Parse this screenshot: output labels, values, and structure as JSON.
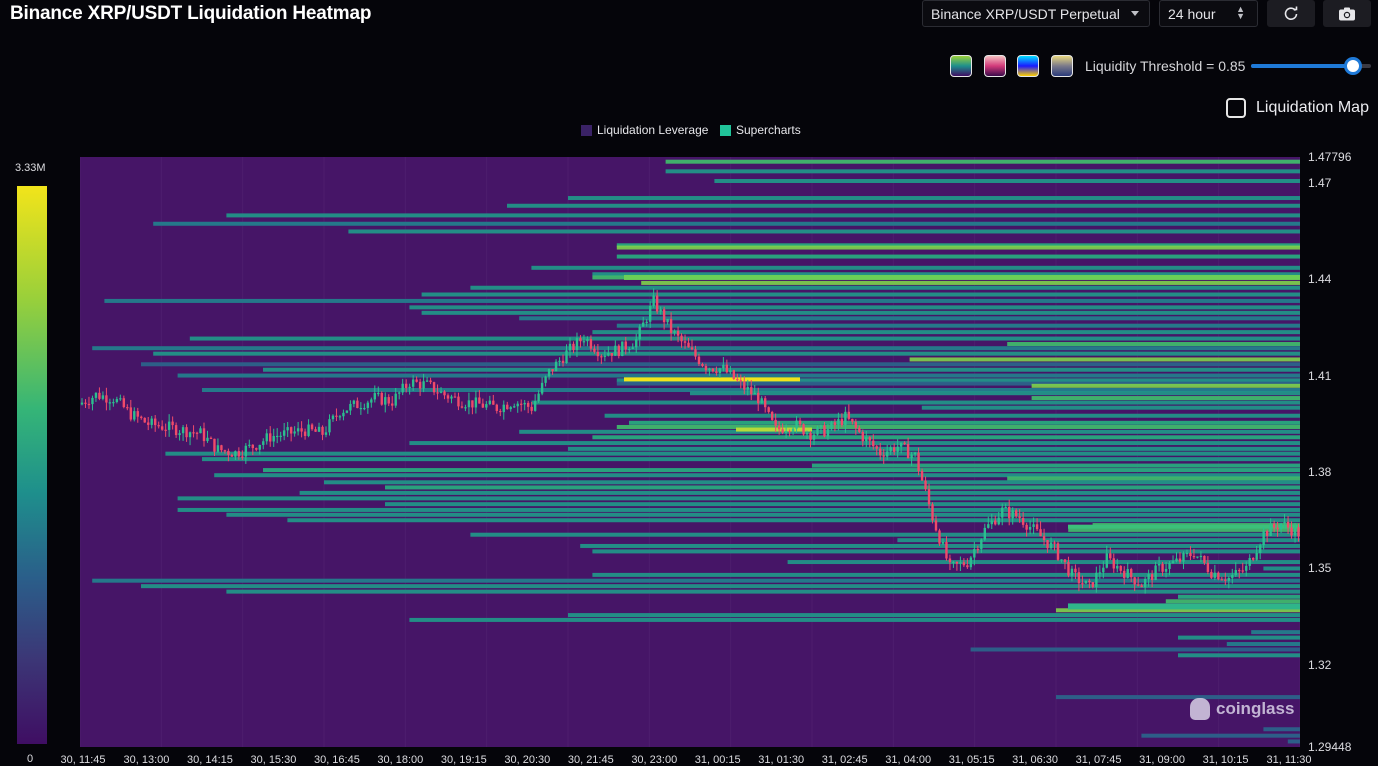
{
  "header": {
    "title": "Binance XRP/USDT Liquidation Heatmap",
    "symbol_select": "Binance XRP/USDT Perpetual",
    "period_select": "24 hour",
    "refresh_icon": "refresh-icon",
    "camera_icon": "camera-icon"
  },
  "controls": {
    "threshold_label": "Liquidity Threshold = 0.85",
    "threshold_value": 0.85,
    "liquidation_map_label": "Liquidation Map",
    "liquidation_map_checked": false,
    "palettes": [
      {
        "name": "palette-viridis",
        "from": "#35b577",
        "to": "#3f0e63"
      },
      {
        "name": "palette-magma",
        "from": "#f07ba0",
        "to": "#3a0a4a"
      },
      {
        "name": "palette-jet",
        "from": "#00e0ff",
        "to": "#1a1aff"
      },
      {
        "name": "palette-cividis",
        "from": "#e8d880",
        "to": "#2a3a7a"
      }
    ]
  },
  "colors": {
    "background": "#461567",
    "up": "#2bbf8f",
    "down": "#f04a6a",
    "highlight": "#f2e41a"
  },
  "watermark": "coinglass",
  "chart_data": {
    "type": "heatmap",
    "title": "Binance XRP/USDT Liquidation Heatmap",
    "legend": [
      "Liquidation Leverage",
      "Supercharts"
    ],
    "legend_colors": [
      "#3a2266",
      "#21c49a"
    ],
    "colorbar": {
      "max_label": "3.33M",
      "min_label": "0"
    },
    "y_axis": {
      "ticks": [
        "1.47796",
        "1.47",
        "1.44",
        "1.41",
        "1.38",
        "1.35",
        "1.32",
        "1.29448"
      ],
      "min": 1.29448,
      "max": 1.47796
    },
    "x_axis": {
      "ticks": [
        "30, 11:45",
        "30, 13:00",
        "30, 14:15",
        "30, 15:30",
        "30, 16:45",
        "30, 18:00",
        "30, 19:15",
        "30, 20:30",
        "30, 21:45",
        "30, 23:00",
        "31, 00:15",
        "31, 01:30",
        "31, 02:45",
        "31, 04:00",
        "31, 05:15",
        "31, 06:30",
        "31, 07:45",
        "31, 09:00",
        "31, 10:15",
        "31, 11:30"
      ]
    },
    "price_path": [
      1.401,
      1.404,
      1.403,
      1.398,
      1.395,
      1.394,
      1.393,
      1.392,
      1.387,
      1.386,
      1.388,
      1.391,
      1.392,
      1.393,
      1.392,
      1.399,
      1.401,
      1.403,
      1.402,
      1.408,
      1.407,
      1.404,
      1.402,
      1.401,
      1.4,
      1.402,
      1.4,
      1.411,
      1.417,
      1.422,
      1.417,
      1.418,
      1.421,
      1.433,
      1.424,
      1.418,
      1.413,
      1.412,
      1.407,
      1.403,
      1.393,
      1.395,
      1.392,
      1.393,
      1.397,
      1.391,
      1.386,
      1.388,
      1.385,
      1.366,
      1.35,
      1.352,
      1.362,
      1.368,
      1.366,
      1.361,
      1.356,
      1.348,
      1.344,
      1.353,
      1.349,
      1.345,
      1.35,
      1.352,
      1.355,
      1.349,
      1.347,
      1.35,
      1.361,
      1.364,
      1.361
    ],
    "bands": [
      {
        "y": 1.4765,
        "start": 0.48,
        "w": 0.8
      },
      {
        "y": 1.4735,
        "start": 0.48,
        "w": 0.5
      },
      {
        "y": 1.4705,
        "start": 0.52,
        "w": 0.5
      },
      {
        "y": 1.4652,
        "start": 0.4,
        "w": 0.5
      },
      {
        "y": 1.4628,
        "start": 0.35,
        "w": 0.6
      },
      {
        "y": 1.4598,
        "start": 0.12,
        "w": 0.5
      },
      {
        "y": 1.4572,
        "start": 0.06,
        "w": 0.45
      },
      {
        "y": 1.4548,
        "start": 0.22,
        "w": 0.5
      },
      {
        "y": 1.4505,
        "start": 0.44,
        "w": 0.65
      },
      {
        "y": 1.4498,
        "start": 0.44,
        "w": 0.95
      },
      {
        "y": 1.447,
        "start": 0.44,
        "w": 0.7
      },
      {
        "y": 1.4435,
        "start": 0.37,
        "w": 0.5
      },
      {
        "y": 1.4415,
        "start": 0.42,
        "w": 0.6
      },
      {
        "y": 1.4405,
        "start": 0.42,
        "w": 0.8
      },
      {
        "y": 1.4388,
        "start": 0.46,
        "w": 1.0
      },
      {
        "y": 1.4373,
        "start": 0.32,
        "w": 0.55
      },
      {
        "y": 1.4352,
        "start": 0.28,
        "w": 0.5
      },
      {
        "y": 1.4332,
        "start": 0.02,
        "w": 0.4
      },
      {
        "y": 1.4312,
        "start": 0.27,
        "w": 0.6
      },
      {
        "y": 1.4295,
        "start": 0.28,
        "w": 0.6
      },
      {
        "y": 1.4278,
        "start": 0.36,
        "w": 0.45
      },
      {
        "y": 1.4255,
        "start": 0.44,
        "w": 0.45
      },
      {
        "y": 1.4235,
        "start": 0.42,
        "w": 0.5
      },
      {
        "y": 1.4215,
        "start": 0.09,
        "w": 0.5
      },
      {
        "y": 1.4198,
        "start": 0.76,
        "w": 0.75
      },
      {
        "y": 1.4185,
        "start": 0.01,
        "w": 0.45
      },
      {
        "y": 1.4168,
        "start": 0.06,
        "w": 0.55
      },
      {
        "y": 1.415,
        "start": 0.68,
        "w": 0.9
      },
      {
        "y": 1.4135,
        "start": 0.05,
        "w": 0.35
      },
      {
        "y": 1.4118,
        "start": 0.15,
        "w": 0.5
      },
      {
        "y": 1.41,
        "start": 0.08,
        "w": 0.45
      },
      {
        "y": 1.4085,
        "start": 0.44,
        "w": 0.6
      },
      {
        "y": 1.4075,
        "start": 0.44,
        "w": 0.3
      },
      {
        "y": 1.4068,
        "start": 0.78,
        "w": 0.9
      },
      {
        "y": 1.4055,
        "start": 0.1,
        "w": 0.45
      },
      {
        "y": 1.4045,
        "start": 0.5,
        "w": 0.6
      },
      {
        "y": 1.403,
        "start": 0.78,
        "w": 0.8
      },
      {
        "y": 1.4016,
        "start": 0.37,
        "w": 0.5
      },
      {
        "y": 1.4,
        "start": 0.69,
        "w": 0.55
      },
      {
        "y": 1.3975,
        "start": 0.43,
        "w": 0.55
      },
      {
        "y": 1.3953,
        "start": 0.45,
        "w": 0.7
      },
      {
        "y": 1.394,
        "start": 0.44,
        "w": 0.8
      },
      {
        "y": 1.3925,
        "start": 0.36,
        "w": 0.6
      },
      {
        "y": 1.3908,
        "start": 0.42,
        "w": 0.65
      },
      {
        "y": 1.389,
        "start": 0.27,
        "w": 0.55
      },
      {
        "y": 1.3872,
        "start": 0.4,
        "w": 0.6
      },
      {
        "y": 1.3857,
        "start": 0.07,
        "w": 0.55
      },
      {
        "y": 1.384,
        "start": 0.1,
        "w": 0.5
      },
      {
        "y": 1.382,
        "start": 0.6,
        "w": 0.7
      },
      {
        "y": 1.3806,
        "start": 0.15,
        "w": 0.65
      },
      {
        "y": 1.379,
        "start": 0.11,
        "w": 0.55
      },
      {
        "y": 1.378,
        "start": 0.76,
        "w": 0.85
      },
      {
        "y": 1.3768,
        "start": 0.2,
        "w": 0.6
      },
      {
        "y": 1.3752,
        "start": 0.25,
        "w": 0.65
      },
      {
        "y": 1.3735,
        "start": 0.18,
        "w": 0.55
      },
      {
        "y": 1.3718,
        "start": 0.08,
        "w": 0.5
      },
      {
        "y": 1.37,
        "start": 0.25,
        "w": 0.5
      },
      {
        "y": 1.3682,
        "start": 0.08,
        "w": 0.55
      },
      {
        "y": 1.3667,
        "start": 0.12,
        "w": 0.55
      },
      {
        "y": 1.365,
        "start": 0.17,
        "w": 0.6
      },
      {
        "y": 1.3635,
        "start": 0.83,
        "w": 0.8
      },
      {
        "y": 1.362,
        "start": 0.81,
        "w": 0.85
      },
      {
        "y": 1.3605,
        "start": 0.32,
        "w": 0.5
      },
      {
        "y": 1.3588,
        "start": 0.67,
        "w": 0.55
      },
      {
        "y": 1.357,
        "start": 0.41,
        "w": 0.5
      },
      {
        "y": 1.3553,
        "start": 0.42,
        "w": 0.5
      },
      {
        "y": 1.352,
        "start": 0.58,
        "w": 0.5
      },
      {
        "y": 1.35,
        "start": 0.97,
        "w": 0.5
      },
      {
        "y": 1.348,
        "start": 0.42,
        "w": 0.5
      },
      {
        "y": 1.3462,
        "start": 0.01,
        "w": 0.45
      },
      {
        "y": 1.3445,
        "start": 0.05,
        "w": 0.5
      },
      {
        "y": 1.3428,
        "start": 0.12,
        "w": 0.55
      },
      {
        "y": 1.3412,
        "start": 0.9,
        "w": 0.7
      },
      {
        "y": 1.3398,
        "start": 0.89,
        "w": 0.8
      },
      {
        "y": 1.3384,
        "start": 0.82,
        "w": 0.85
      },
      {
        "y": 1.337,
        "start": 0.8,
        "w": 0.9
      },
      {
        "y": 1.3355,
        "start": 0.4,
        "w": 0.6
      },
      {
        "y": 1.334,
        "start": 0.27,
        "w": 0.5
      },
      {
        "y": 1.3302,
        "start": 0.96,
        "w": 0.45
      },
      {
        "y": 1.3285,
        "start": 0.9,
        "w": 0.5
      },
      {
        "y": 1.3265,
        "start": 0.94,
        "w": 0.45
      },
      {
        "y": 1.3248,
        "start": 0.73,
        "w": 0.35
      },
      {
        "y": 1.323,
        "start": 0.9,
        "w": 0.5
      },
      {
        "y": 1.31,
        "start": 0.8,
        "w": 0.3
      },
      {
        "y": 1.3,
        "start": 0.97,
        "w": 0.35
      },
      {
        "y": 1.298,
        "start": 0.87,
        "w": 0.35
      },
      {
        "y": 1.2962,
        "start": 0.99,
        "w": 0.3
      }
    ]
  }
}
